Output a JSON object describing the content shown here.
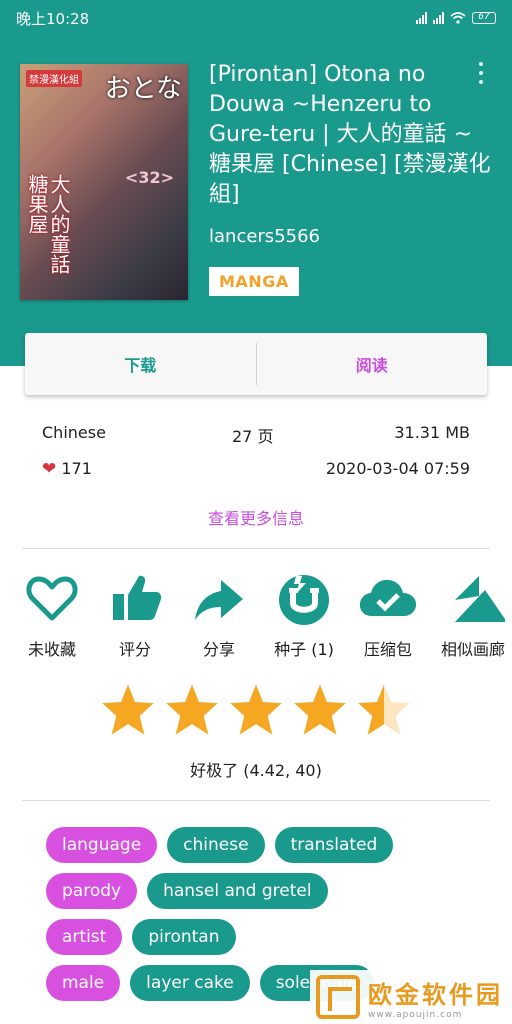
{
  "status_bar": {
    "time": "晚上10:28",
    "battery": "67"
  },
  "gallery": {
    "title": "[Pirontan] Otona no Douwa ~Henzeru to Gure-teru | 大人的童話 ~ 糖果屋 [Chinese] [禁漫漢化組]",
    "uploader": "lancers5566",
    "category": "MANGA",
    "cover": {
      "stamp": "禁漫漢化組",
      "big_text": "おとな",
      "vertical_title": "大人的童話 糖果屋",
      "number": "<32>"
    }
  },
  "actions": {
    "download_label": "下载",
    "read_label": "阅读",
    "download_color": "#1a9a8c",
    "read_color": "#c94fdc"
  },
  "info": {
    "language": "Chinese",
    "pages": "27 页",
    "size": "31.31 MB",
    "favorites": "171",
    "posted": "2020-03-04 07:59",
    "more_info": "查看更多信息"
  },
  "icon_actions": [
    {
      "icon": "heart-outline-icon",
      "label": "未收藏"
    },
    {
      "icon": "thumbs-up-icon",
      "label": "评分"
    },
    {
      "icon": "share-arrow-icon",
      "label": "分享"
    },
    {
      "icon": "torrent-icon",
      "label": "种子 (1)"
    },
    {
      "icon": "cloud-check-icon",
      "label": "压缩包"
    },
    {
      "icon": "similar-triangles-icon",
      "label": "相似画廊"
    }
  ],
  "rating": {
    "stars": 4.42,
    "text": "好极了 (4.42, 40)",
    "star_color": "#f5a623"
  },
  "tags": [
    {
      "namespace": "language",
      "values": [
        "chinese",
        "translated"
      ]
    },
    {
      "namespace": "parody",
      "values": [
        "hansel and gretel"
      ]
    },
    {
      "namespace": "artist",
      "values": [
        "pirontan"
      ]
    },
    {
      "namespace": "male",
      "values": [
        "layer cake",
        "sole male"
      ]
    }
  ],
  "watermark": {
    "cn": "欧金软件园",
    "en": "www.apoujin.com"
  },
  "colors": {
    "primary": "#1a9a8c",
    "accent": "#c94fdc",
    "tag_namespace": "#d850e0",
    "category": "#f0a22a"
  }
}
